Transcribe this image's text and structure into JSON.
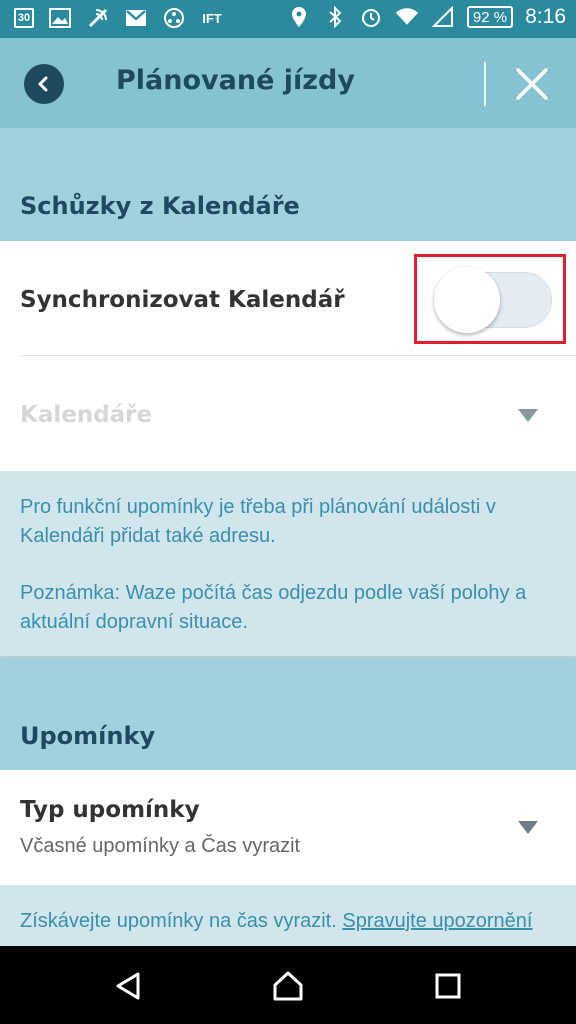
{
  "status_bar": {
    "calendar_day": "30",
    "ift_label": "IFT",
    "battery_percent": "92 %",
    "time": "8:16"
  },
  "app_bar": {
    "title": "Plánované jízdy"
  },
  "calendar_section": {
    "header": "Schůzky z Kalendáře",
    "sync_label": "Synchronizovat Kalendář",
    "sync_enabled": false,
    "calendars_label": "Kalendáře",
    "info_text": "Pro funkční upomínky je třeba při plánování události v Kalendáři přidat také adresu.",
    "note_text": "Poznámka: Waze počítá čas odjezdu podle vaší polohy a aktuální dopravní situace."
  },
  "reminders_section": {
    "header": "Upomínky",
    "type_label": "Typ upomínky",
    "type_value": "Včasné upomínky a Čas vyrazit",
    "info_text": "Získávejte upomínky na čas vyrazit.",
    "manage_link": "Spravujte upozornění"
  },
  "colors": {
    "status_bar": "#2b8a9d",
    "app_bar": "#86c3d2",
    "section_header": "#a1d1dd",
    "title_text": "#1e4a5f",
    "info_text": "#3a8fae",
    "highlight": "#e01e2e"
  },
  "icons": {
    "status_left": [
      "calendar-icon",
      "image-icon",
      "wifi-call-icon",
      "gmail-icon",
      "app-icon",
      "ift-icon"
    ],
    "status_right": [
      "location-icon",
      "bluetooth-icon",
      "alarm-icon",
      "wifi-icon",
      "signal-icon",
      "battery-icon"
    ],
    "nav": [
      "back-triangle-icon",
      "home-icon",
      "recents-icon"
    ]
  }
}
